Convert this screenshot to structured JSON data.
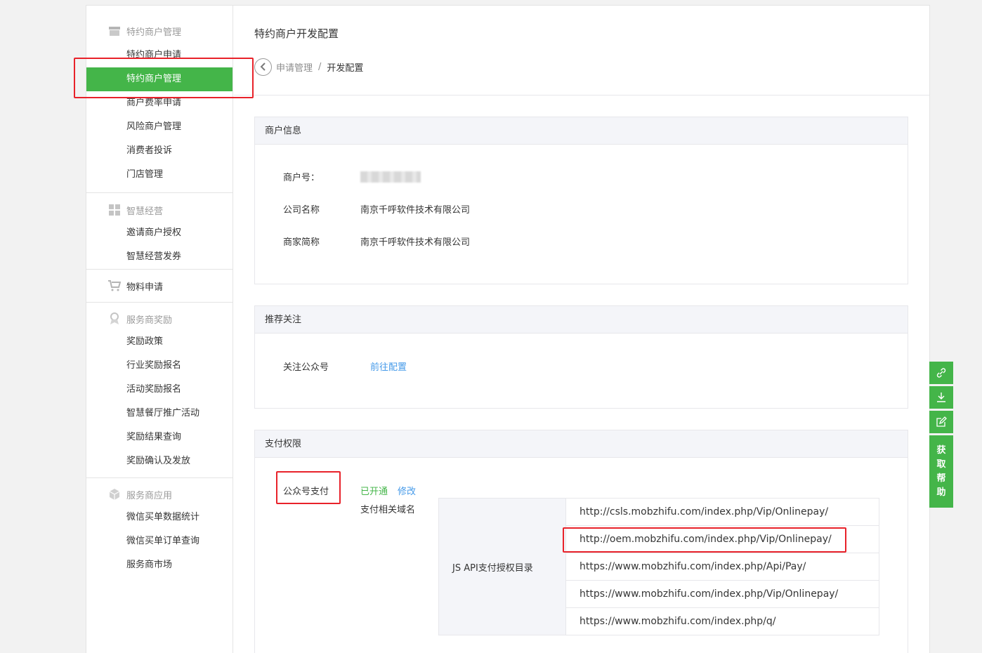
{
  "sidebar": {
    "groups": [
      {
        "title": "特约商户管理",
        "icon": "store-icon",
        "items": [
          "特约商户申请",
          "特约商户管理",
          "商户费率申请",
          "风险商户管理",
          "消费者投诉",
          "门店管理"
        ],
        "active": 1
      },
      {
        "title": "智慧经营",
        "icon": "grid-icon",
        "items": [
          "邀请商户授权",
          "智慧经营发券"
        ]
      },
      {
        "title": "物料申请",
        "icon": "cart-icon",
        "items": []
      },
      {
        "title": "服务商奖励",
        "icon": "award-icon",
        "items": [
          "奖励政策",
          "行业奖励报名",
          "活动奖励报名",
          "智慧餐厅推广活动",
          "奖励结果查询",
          "奖励确认及发放"
        ]
      },
      {
        "title": "服务商应用",
        "icon": "cube-icon",
        "items": [
          "微信买单数据统计",
          "微信买单订单查询",
          "服务商市场"
        ]
      }
    ]
  },
  "header": {
    "title": "特约商户开发配置",
    "breadcrumb": {
      "parent": "申请管理",
      "separator": "/",
      "current": "开发配置"
    }
  },
  "merchant_info": {
    "title": "商户信息",
    "merchant_id_label": "商户号：",
    "company_label": "公司名称",
    "company_value": "南京千呼软件技术有限公司",
    "short_label": "商家简称",
    "short_value": "南京千呼软件技术有限公司"
  },
  "follow": {
    "title": "推荐关注",
    "label": "关注公众号",
    "link": "前往配置"
  },
  "payment": {
    "title": "支付权限",
    "type_label": "公众号支付",
    "status": "已开通",
    "modify": "修改",
    "domain_label": "支付相关域名",
    "jsapi_label": "JS API支付授权目录",
    "urls": [
      "http://csls.mobzhifu.com/index.php/Vip/Onlinepay/",
      "http://oem.mobzhifu.com/index.php/Vip/Onlinepay/",
      "https://www.mobzhifu.com/index.php/Api/Pay/",
      "https://www.mobzhifu.com/index.php/Vip/Onlinepay/",
      "https://www.mobzhifu.com/index.php/q/"
    ]
  },
  "float_tools": {
    "icons": [
      "link-icon",
      "download-icon",
      "edit-icon"
    ],
    "help_chars": [
      "获",
      "取",
      "帮",
      "助"
    ]
  },
  "colors": {
    "accent": "#44b549",
    "link": "#459ae9",
    "highlight": "#e8222a"
  }
}
